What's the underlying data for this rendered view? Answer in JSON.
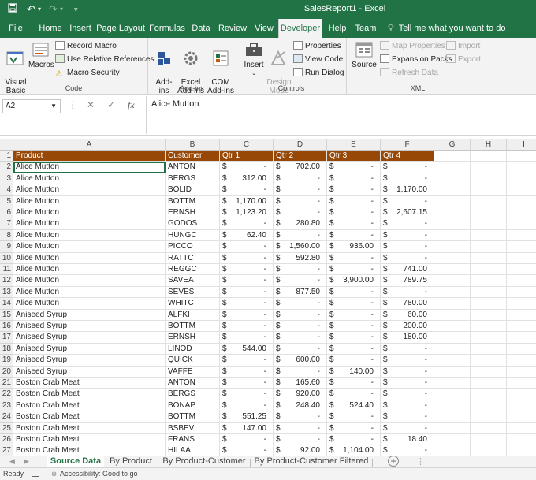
{
  "window": {
    "title": "SalesReport1  -  Excel"
  },
  "tabs": [
    "File",
    "Home",
    "Insert",
    "Page Layout",
    "Formulas",
    "Data",
    "Review",
    "View",
    "Developer",
    "Help",
    "Team"
  ],
  "active_tab": "Developer",
  "tell_me": "Tell me what you want to do",
  "ribbon": {
    "code": {
      "label": "Code",
      "visual_basic": "Visual\nBasic",
      "macros": "Macros",
      "record_macro": "Record Macro",
      "relative_refs": "Use Relative References",
      "macro_security": "Macro Security"
    },
    "addins": {
      "label": "Add-ins",
      "addins": "Add-\nins",
      "excel_addins": "Excel\nAdd-ins",
      "com_addins": "COM\nAdd-ins"
    },
    "controls": {
      "label": "Controls",
      "insert": "Insert",
      "design_mode": "Design\nMode",
      "properties": "Properties",
      "view_code": "View Code",
      "run_dialog": "Run Dialog"
    },
    "xml": {
      "label": "XML",
      "source": "Source",
      "map_properties": "Map Properties",
      "expansion_packs": "Expansion Packs",
      "refresh_data": "Refresh Data",
      "import": "Import",
      "export": "Export"
    }
  },
  "formula_bar": {
    "name_box": "A2",
    "content": "Alice Mutton"
  },
  "columns": [
    "A",
    "B",
    "C",
    "D",
    "E",
    "F",
    "G",
    "H",
    "I"
  ],
  "headers": [
    "Product",
    "Customer",
    "Qtr 1",
    "Qtr 2",
    "Qtr 3",
    "Qtr 4"
  ],
  "rows": [
    [
      "Alice Mutton",
      "ANTON",
      "-",
      "702.00",
      "-",
      "-"
    ],
    [
      "Alice Mutton",
      "BERGS",
      "312.00",
      "-",
      "-",
      "-"
    ],
    [
      "Alice Mutton",
      "BOLID",
      "-",
      "-",
      "-",
      "1,170.00"
    ],
    [
      "Alice Mutton",
      "BOTTM",
      "1,170.00",
      "-",
      "-",
      "-"
    ],
    [
      "Alice Mutton",
      "ERNSH",
      "1,123.20",
      "-",
      "-",
      "2,607.15"
    ],
    [
      "Alice Mutton",
      "GODOS",
      "-",
      "280.80",
      "-",
      "-"
    ],
    [
      "Alice Mutton",
      "HUNGC",
      "62.40",
      "-",
      "-",
      "-"
    ],
    [
      "Alice Mutton",
      "PICCO",
      "-",
      "1,560.00",
      "936.00",
      "-"
    ],
    [
      "Alice Mutton",
      "RATTC",
      "-",
      "592.80",
      "-",
      "-"
    ],
    [
      "Alice Mutton",
      "REGGC",
      "-",
      "-",
      "-",
      "741.00"
    ],
    [
      "Alice Mutton",
      "SAVEA",
      "-",
      "-",
      "3,900.00",
      "789.75"
    ],
    [
      "Alice Mutton",
      "SEVES",
      "-",
      "877.50",
      "-",
      "-"
    ],
    [
      "Alice Mutton",
      "WHITC",
      "-",
      "-",
      "-",
      "780.00"
    ],
    [
      "Aniseed Syrup",
      "ALFKI",
      "-",
      "-",
      "-",
      "60.00"
    ],
    [
      "Aniseed Syrup",
      "BOTTM",
      "-",
      "-",
      "-",
      "200.00"
    ],
    [
      "Aniseed Syrup",
      "ERNSH",
      "-",
      "-",
      "-",
      "180.00"
    ],
    [
      "Aniseed Syrup",
      "LINOD",
      "544.00",
      "-",
      "-",
      "-"
    ],
    [
      "Aniseed Syrup",
      "QUICK",
      "-",
      "600.00",
      "-",
      "-"
    ],
    [
      "Aniseed Syrup",
      "VAFFE",
      "-",
      "-",
      "140.00",
      "-"
    ],
    [
      "Boston Crab Meat",
      "ANTON",
      "-",
      "165.60",
      "-",
      "-"
    ],
    [
      "Boston Crab Meat",
      "BERGS",
      "-",
      "920.00",
      "-",
      "-"
    ],
    [
      "Boston Crab Meat",
      "BONAP",
      "-",
      "248.40",
      "524.40",
      "-"
    ],
    [
      "Boston Crab Meat",
      "BOTTM",
      "551.25",
      "-",
      "-",
      "-"
    ],
    [
      "Boston Crab Meat",
      "BSBEV",
      "147.00",
      "-",
      "-",
      "-"
    ],
    [
      "Boston Crab Meat",
      "FRANS",
      "-",
      "-",
      "-",
      "18.40"
    ],
    [
      "Boston Crab Meat",
      "HILAA",
      "-",
      "92.00",
      "1,104.00",
      "-"
    ]
  ],
  "currency": "$",
  "sheets": [
    "Source Data",
    "By Product",
    "By Product-Customer",
    "By Product-Customer Filtered"
  ],
  "active_sheet": "Source Data",
  "status": {
    "ready": "Ready",
    "accessibility": "Accessibility: Good to go"
  },
  "colors": {
    "excel_green": "#217346",
    "header_fill": "#974806"
  }
}
